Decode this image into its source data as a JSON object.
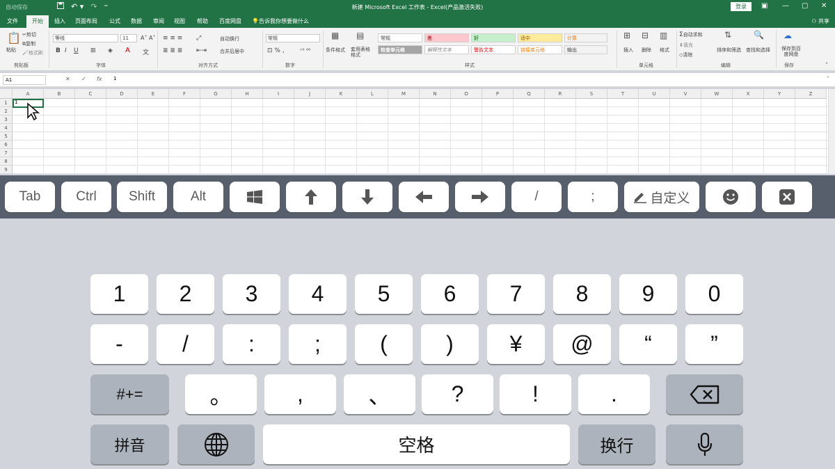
{
  "excel": {
    "autosave": "自动保存",
    "window_title": "新建 Microsoft Excel 工作表 - Excel(产品激活失败)",
    "login": "登录",
    "share": "共享",
    "tabs": [
      "文件",
      "开始",
      "插入",
      "页面布局",
      "公式",
      "数据",
      "审阅",
      "视图",
      "帮助",
      "百度网盘"
    ],
    "active_tab": "开始",
    "tell_me": "告诉我你想要做什么",
    "ribbon": {
      "clipboard": {
        "paste": "粘贴",
        "cut": "剪切",
        "copy": "复制",
        "format_painter": "格式刷",
        "label": "剪贴板"
      },
      "font": {
        "name": "等线",
        "size": "11",
        "label": "字体"
      },
      "alignment": {
        "wrap": "自动换行",
        "merge": "合并后居中",
        "label": "对齐方式"
      },
      "number": {
        "format": "常规",
        "label": "数字"
      },
      "styles": {
        "conditional": "条件格式",
        "table": "套用表格格式",
        "cells": [
          "常规",
          "差",
          "好",
          "适中",
          "计算",
          "检查单元格",
          "解释性文本",
          "警告文本",
          "链接单元格",
          "输出"
        ],
        "label": "样式"
      },
      "cells": {
        "insert": "插入",
        "delete": "删除",
        "format": "格式",
        "label": "单元格"
      },
      "editing": {
        "autosum": "自动求和",
        "fill": "填充",
        "clear": "清除",
        "sort": "排序和筛选",
        "find": "查找和选择",
        "label": "编辑"
      },
      "save": {
        "save_to": "保存到百度网盘",
        "label": "保存"
      }
    },
    "namebox": "A1",
    "formula_value": "1",
    "columns": [
      "A",
      "B",
      "C",
      "D",
      "E",
      "F",
      "G",
      "H",
      "I",
      "J",
      "K",
      "L",
      "M",
      "N",
      "O",
      "P",
      "Q",
      "R",
      "S",
      "T",
      "U",
      "V",
      "W",
      "X",
      "Y",
      "Z"
    ],
    "rows": [
      "1",
      "2",
      "3",
      "4",
      "5",
      "6",
      "7",
      "8",
      "9"
    ],
    "cell_a1": "1"
  },
  "function_keys": [
    "Tab",
    "Ctrl",
    "Shift",
    "Alt",
    "",
    "",
    "",
    "",
    "",
    "/",
    ";",
    "自定义",
    "",
    ""
  ],
  "keyboard": {
    "row1": [
      "1",
      "2",
      "3",
      "4",
      "5",
      "6",
      "7",
      "8",
      "9",
      "0"
    ],
    "row2": [
      "-",
      "/",
      ":",
      ";",
      "(",
      ")",
      "¥",
      "@",
      "“",
      "”"
    ],
    "row3": [
      "#+=",
      "。",
      ",",
      "、",
      "?",
      "!",
      "."
    ],
    "row4": [
      "拼音",
      "",
      "空格",
      "换行",
      ""
    ]
  },
  "colors": {
    "excel_green": "#217346",
    "fkey_bar": "#565f6b",
    "keyboard_bg": "#d1d5db",
    "fn_key": "#adb3bd"
  }
}
